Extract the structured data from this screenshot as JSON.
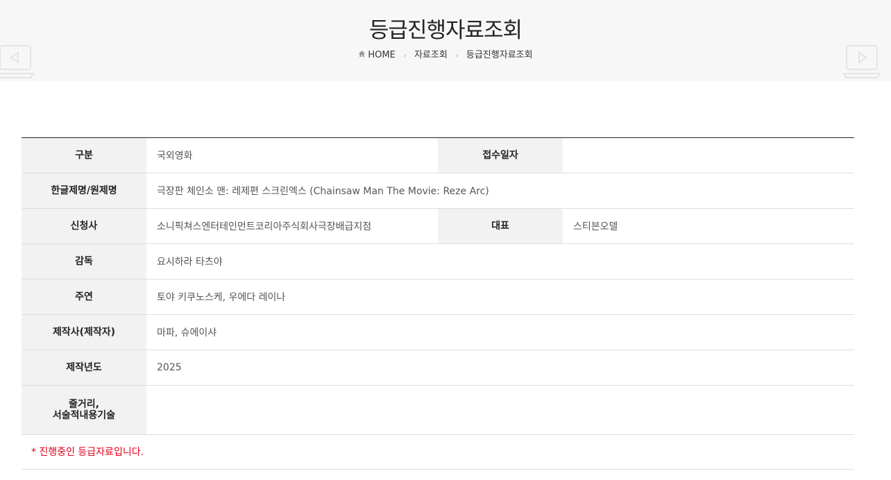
{
  "header": {
    "title": "등급진행자료조회",
    "breadcrumb": [
      "HOME",
      "자료조회",
      "등급진행자료조회"
    ]
  },
  "table": {
    "category_label": "구분",
    "category_value": "국외영화",
    "receipt_date_label": "접수일자",
    "receipt_date_value": "",
    "title_label": "한글제명/원제명",
    "title_value": "극장판 체인소 맨: 레제편 스크린엑스  (Chainsaw Man The Movie: Reze Arc)",
    "applicant_label": "신청사",
    "applicant_value": "소니픽쳐스엔터테인먼트코리아주식회사극장배급지점",
    "representative_label": "대표",
    "representative_value": "스티븐오델",
    "director_label": "감독",
    "director_value": "요시하라 타츠야",
    "cast_label": "주연",
    "cast_value": "토야 키쿠노스케, 우에다 레이나",
    "producer_label": "제작사(제작자)",
    "producer_value": "마파, 슈에이샤",
    "year_label": "제작년도",
    "year_value": "2025",
    "synopsis_label_line1": "줄거리,",
    "synopsis_label_line2": "서술적내용기술",
    "synopsis_value": ""
  },
  "notice": "* 진행중인 등급자료입니다.",
  "colors": {
    "header_bg": "#f7f7f7",
    "label_bg": "#f2f2f2",
    "notice_red": "#e2001a"
  }
}
